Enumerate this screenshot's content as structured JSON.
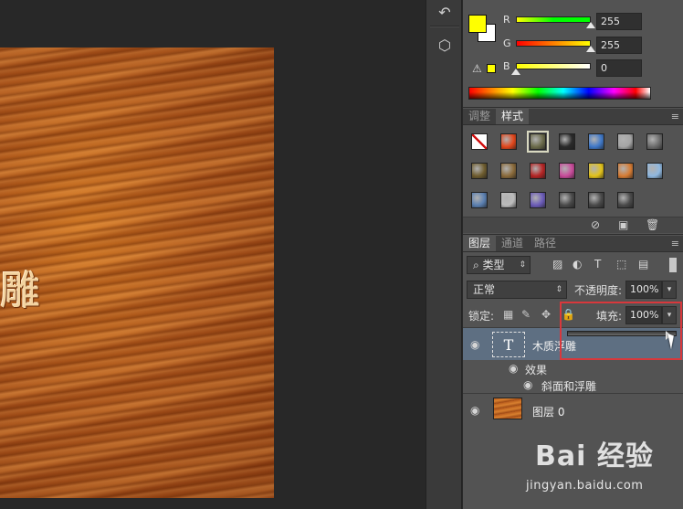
{
  "canvas": {
    "text": "雕"
  },
  "color_panel": {
    "channels": [
      {
        "label": "R",
        "value": "255",
        "thumb_pct": 100,
        "track": "linear-gradient(90deg,#ffff00,#00ff00)"
      },
      {
        "label": "G",
        "value": "255",
        "thumb_pct": 100,
        "track": "linear-gradient(90deg,#ff0000,#ffff00)"
      },
      {
        "label": "B",
        "value": "0",
        "thumb_pct": 0,
        "track": "linear-gradient(90deg,#ffff00,#ffffff)"
      }
    ],
    "foreground": "#ffff00",
    "background": "#ffffff"
  },
  "styles_panel": {
    "tabs": [
      {
        "label": "调整",
        "active": false
      },
      {
        "label": "样式",
        "active": true
      }
    ],
    "menu_icon": "≡",
    "swatches": [
      {
        "name": "none-style-swatch",
        "color": "none"
      },
      {
        "name": "fire-style-swatch",
        "color": "#e2461b"
      },
      {
        "name": "frame-style-swatch",
        "color": "#6b6b4a",
        "selected": true
      },
      {
        "name": "chrome-button-style-swatch",
        "color": "#2a2a2a"
      },
      {
        "name": "blue-glass-style-swatch",
        "color": "#3f78c8"
      },
      {
        "name": "gray-style-swatch",
        "color": "#a5a5a5"
      },
      {
        "name": "dark-bevel-style-swatch",
        "color": "#6b6b6b"
      },
      {
        "name": "olive-style-swatch",
        "color": "#6e5c2e"
      },
      {
        "name": "brown-style-swatch",
        "color": "#8a6a3a"
      },
      {
        "name": "red-style-swatch",
        "color": "#b52424"
      },
      {
        "name": "rainbow-style-swatch",
        "color": "#c84a9a"
      },
      {
        "name": "gold-style-swatch",
        "color": "#e2c21a"
      },
      {
        "name": "sunset-style-swatch",
        "color": "#d57b33"
      },
      {
        "name": "sky-style-swatch",
        "color": "#8fb8e0"
      },
      {
        "name": "landscape-style-swatch",
        "color": "#5a7fb0"
      },
      {
        "name": "pattern-style-swatch",
        "color": "#bcbcbc"
      },
      {
        "name": "purple-glow-style-swatch",
        "color": "#6b5bb8"
      },
      {
        "name": "empty-style-swatch-1",
        "color": "#4a4a4a"
      },
      {
        "name": "empty-style-swatch-2",
        "color": "#4a4a4a"
      },
      {
        "name": "empty-style-swatch-3",
        "color": "#4a4a4a"
      }
    ]
  },
  "layers_panel": {
    "tabs": [
      {
        "label": "图层",
        "active": true
      },
      {
        "label": "通道",
        "active": false
      },
      {
        "label": "路径",
        "active": false
      }
    ],
    "menu_icon": "≡",
    "filter_kind": "类型",
    "blend_mode": "正常",
    "opacity_label": "不透明度:",
    "opacity_value": "100%",
    "lock_label": "锁定:",
    "fill_label": "填充:",
    "fill_value": "100%",
    "layers": [
      {
        "name": "木质浮雕",
        "type": "text",
        "selected": true
      },
      {
        "name": "图层 0",
        "type": "image",
        "selected": false
      }
    ],
    "effects_label": "效果",
    "effect_items": [
      "斜面和浮雕"
    ]
  },
  "watermark": {
    "logo": "Bai 经验",
    "url": "jingyan.baidu.com"
  }
}
